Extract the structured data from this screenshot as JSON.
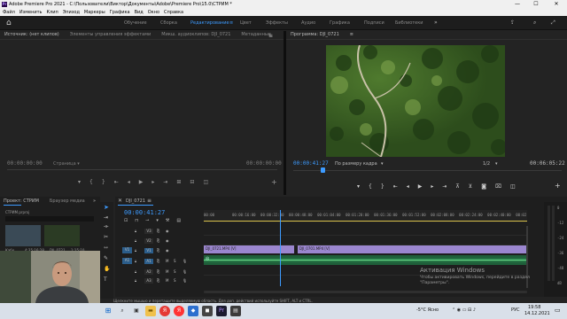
{
  "window": {
    "icon_text": "Pr",
    "title": "Adobe Premiere Pro 2021 - C:\\Пользователи\\Виктор\\Документы\\Adobe\\Premiere Pro\\15.0\\СТРИМ *",
    "min": "—",
    "max": "☐",
    "close": "✕"
  },
  "menu": [
    "Файл",
    "Изменить",
    "Клип",
    "Эпизод",
    "Маркеры",
    "Графика",
    "Вид",
    "Окно",
    "Справка"
  ],
  "workspace": {
    "tabs": [
      "Обучение",
      "Сборка",
      "Редактирование",
      "Цвет",
      "Эффекты",
      "Аудио",
      "Графика",
      "Подписи",
      "Библиотеки"
    ],
    "active_index": 2,
    "menu_glyph": "≡",
    "more": "»"
  },
  "source_panel": {
    "tabs": [
      "Источник: (нет клипов)",
      "Элементы управления эффектами",
      "Микш. аудиоклипов: DJI_0721",
      "Метаданные"
    ],
    "menu_glyph": "≡",
    "timecode_left": "00:00:00:00",
    "timecode_right": "00:00:00:00",
    "fit_label": "Страница ▾"
  },
  "program_panel": {
    "title": "Программа: DJI_0721",
    "menu_glyph": "≡",
    "timecode": "00:00:41:27",
    "fit": "По размеру кадра",
    "quality": "1/2",
    "duration": "00:06:05:22"
  },
  "project_panel": {
    "tabs": [
      "Проект: СТРИМ",
      "Браузер медиа"
    ],
    "more": "»",
    "file": "СТРИМ.prproj",
    "items": [
      {
        "name": "Кабо",
        "duration": "4:35:16:28"
      },
      {
        "name": "DJI_0721",
        "duration": "1:15:10"
      }
    ]
  },
  "timeline": {
    "sequence": "DJI_0721",
    "menu_glyph": "≡",
    "timecode": "00:00:41:27",
    "ruler": [
      "00:00",
      "00:00:16:00",
      "00:00:32:00",
      "00:00:48:00",
      "00:01:04:00",
      "00:01:20:00",
      "00:01:36:00",
      "00:01:52:00",
      "00:02:08:00",
      "00:02:24:00",
      "00:02:40:00",
      "00:02"
    ],
    "video_tracks": [
      "V3",
      "V2",
      "V1"
    ],
    "audio_tracks": [
      "A1",
      "A2",
      "A3"
    ],
    "source_patch_v": "V1",
    "source_patch_a": "A1",
    "clips": [
      {
        "label": "DJI_0721.MP4 [V]",
        "track": "V1",
        "start": 0,
        "end": 0.28
      },
      {
        "label": "DJI_0701.MP4 [V]",
        "track": "V1",
        "start": 0.29,
        "end": 1.0
      }
    ],
    "playhead_fraction": 0.236,
    "meter_scale": [
      "0",
      "-12",
      "-24",
      "-36",
      "-48",
      "dB"
    ]
  },
  "status_bar": "Щелкните мышью и перетащите выделяемую область. Для доп. действий используйте SHIFT, ALT и CTRL.",
  "watermark": {
    "title": "Активация Windows",
    "line1": "Чтобы активировать Windows, перейдите в раздел",
    "line2": "\"Параметры\"."
  },
  "taskbar": {
    "weather": "-5°C  Ясно",
    "lang": "РУС",
    "time": "19:58",
    "date": "14.12.2021"
  }
}
